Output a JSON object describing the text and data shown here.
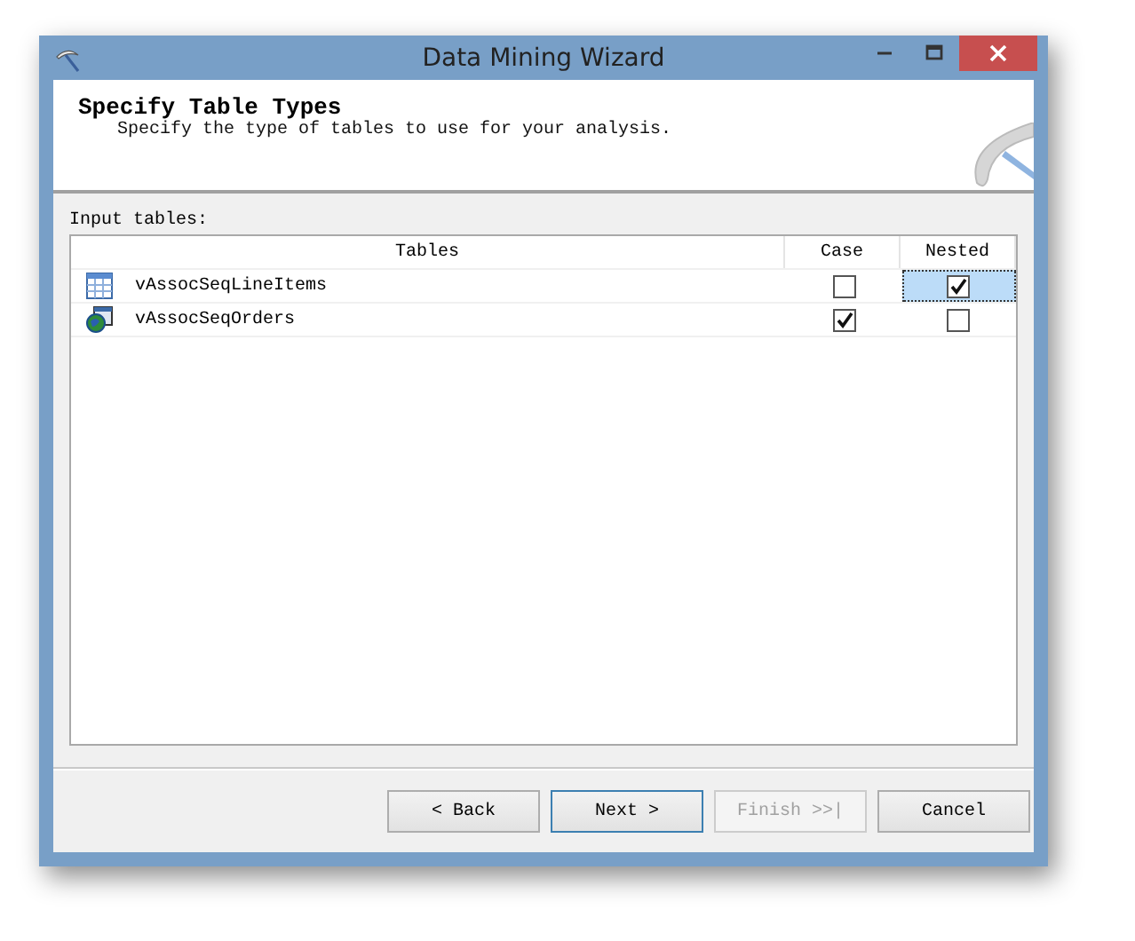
{
  "window": {
    "title": "Data Mining Wizard"
  },
  "header": {
    "title": "Specify Table Types",
    "subtitle": "Specify the type of tables to use for your analysis."
  },
  "input_label": "Input tables:",
  "table": {
    "columns": [
      "Tables",
      "Case",
      "Nested"
    ],
    "rows": [
      {
        "kind": "table",
        "name": "vAssocSeqLineItems",
        "case": {
          "checked": false,
          "selected": false
        },
        "nested": {
          "checked": true,
          "selected": true
        }
      },
      {
        "kind": "view",
        "name": "vAssocSeqOrders",
        "case": {
          "checked": true,
          "selected": false
        },
        "nested": {
          "checked": false,
          "selected": false
        }
      }
    ]
  },
  "buttons": [
    {
      "label": "< Back",
      "disabled": false
    },
    {
      "label": "Next >",
      "disabled": false
    },
    {
      "label": "Finish >>|",
      "disabled": true
    },
    {
      "label": "Cancel",
      "disabled": false
    }
  ]
}
